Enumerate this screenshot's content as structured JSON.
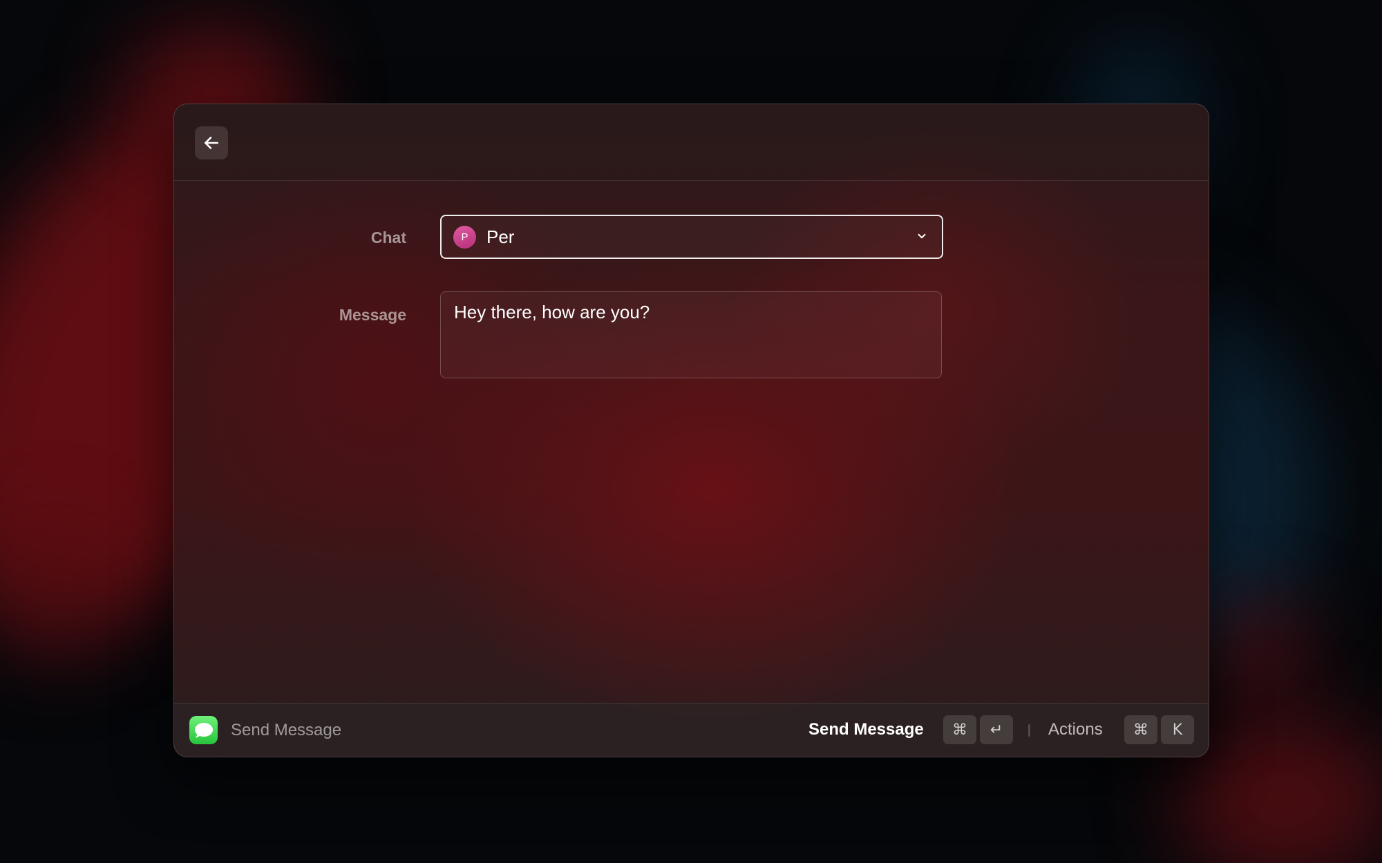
{
  "form": {
    "chat_label": "Chat",
    "chat_value": "Per",
    "chat_avatar_initial": "P",
    "message_label": "Message",
    "message_value": "Hey there, how are you?"
  },
  "footer": {
    "app_title": "Send Message",
    "primary_action": "Send Message",
    "primary_shortcut": [
      "⌘",
      "↵"
    ],
    "secondary_action": "Actions",
    "secondary_shortcut": [
      "⌘",
      "K"
    ]
  },
  "icons": {
    "back": "arrow-left-icon",
    "chevron": "chevron-down-icon",
    "app": "messages-app-icon"
  },
  "colors": {
    "avatar": "#d2468f",
    "app_icon": "#34c759",
    "accent_bg": "#3c1517"
  }
}
